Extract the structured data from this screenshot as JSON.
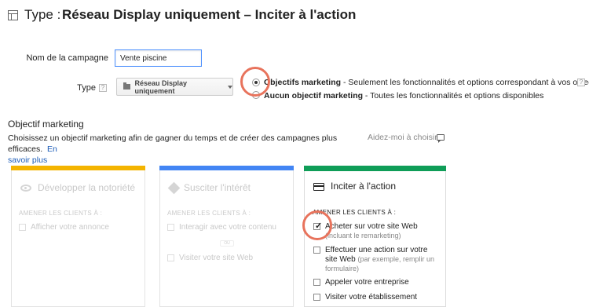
{
  "header": {
    "type_label": "Type :",
    "title": "Réseau Display uniquement – Inciter à l'action"
  },
  "form": {
    "campaign_label": "Nom de la campagne",
    "campaign_value": "Vente piscine",
    "type_label": "Type",
    "type_help": "?",
    "type_select": "Réseau Display uniquement",
    "options": [
      {
        "bold": "Objectifs marketing",
        "text": " - Seulement les fonctionnalités et options correspondant à vos objectifs",
        "selected": true,
        "help": "?"
      },
      {
        "bold": "Aucun objectif marketing",
        "text": " - Toutes les fonctionnalités et options disponibles",
        "selected": false
      }
    ]
  },
  "objective": {
    "heading": "Objectif marketing",
    "description": "Choisissez un objectif marketing afin de gagner du temps et de créer des campagnes plus efficaces.",
    "link_en": "En",
    "link_rest": "savoir plus",
    "help_choose": "Aidez-moi à choisir"
  },
  "cards": [
    {
      "title": "Développer la notoriété",
      "bar_color": "#f4b400",
      "subtitle": "AMENER LES CLIENTS À :",
      "items": [
        {
          "label": "Afficher votre annonce",
          "checked": false
        }
      ]
    },
    {
      "title": "Susciter l'intérêt",
      "bar_color": "#4285f4",
      "subtitle": "AMENER LES CLIENTS À :",
      "items": [
        {
          "label": "Interagir avec votre contenu",
          "checked": false
        },
        {
          "label": "Visiter votre site Web",
          "checked": false
        }
      ],
      "badge": "OU"
    },
    {
      "title": "Inciter à l'action",
      "bar_color": "#0f9d58",
      "subtitle": "AMENER LES CLIENTS À :",
      "items": [
        {
          "label": "Acheter sur votre site Web",
          "note": "(incluant le remarketing)",
          "checked": true
        },
        {
          "label_line1": "Effectuer une action sur votre",
          "label_line2": "site Web",
          "note_inline": "(par exemple, remplir un",
          "note_line3": "formulaire)",
          "checked": false
        },
        {
          "label": "Appeler votre entreprise",
          "checked": false
        },
        {
          "label": "Visiter votre établissement",
          "checked": false
        }
      ]
    }
  ],
  "colors": {
    "highlight_circle": "#e8735c",
    "link": "#1a5bb8",
    "input_border": "#4d90fe"
  }
}
